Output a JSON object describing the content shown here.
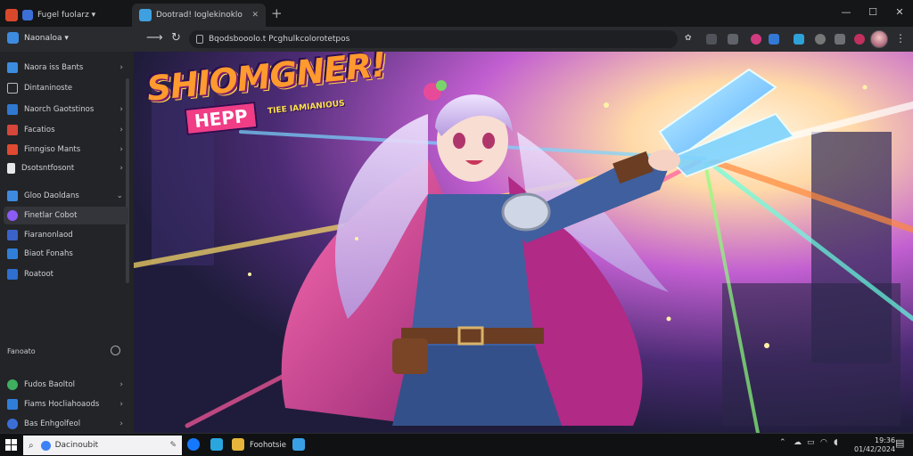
{
  "tabs": [
    {
      "title": "Fugel fuolarz ▾"
    },
    {
      "title": "Dootrad! Ioglekinoklo"
    }
  ],
  "new_tab_label": "+",
  "window_controls": {
    "minimize": "—",
    "maximize": "☐",
    "close": "✕"
  },
  "workspace": {
    "name": "Naonaloa ▾"
  },
  "nav": {
    "back": "⟶",
    "reload": "↻"
  },
  "address_bar": {
    "url": "Bqodsbooolo.t Pcghulkcolorotetpos"
  },
  "sidebar": {
    "items": [
      {
        "label": "Naora iss Bants",
        "chevron": "›"
      },
      {
        "label": "Dintaninoste",
        "chevron": ""
      },
      {
        "label": "Naorch Gaotstinos",
        "chevron": "›"
      },
      {
        "label": "Facatios",
        "chevron": "›"
      },
      {
        "label": "Finngiso Mants",
        "chevron": "›"
      },
      {
        "label": "Dsotsntfosont",
        "chevron": "›"
      },
      {
        "label": "Gloo Daoldans",
        "chevron": "⌄"
      },
      {
        "label": "Finetlar Cobot",
        "chevron": ""
      },
      {
        "label": "Fiaranonlaod",
        "chevron": ""
      },
      {
        "label": "Biaot Fonahs",
        "chevron": ""
      },
      {
        "label": "Roatoot",
        "chevron": ""
      }
    ],
    "section_label": "Fanoato",
    "bottom_items": [
      {
        "label": "Fudos Baoltol",
        "chevron": "›"
      },
      {
        "label": "Fiams Hocliahoaods",
        "chevron": "›"
      },
      {
        "label": "Bas Enhgolfeol",
        "chevron": "›"
      }
    ]
  },
  "artwork": {
    "title_line1": "SHIOMGNER!",
    "title_line2": "HEPP",
    "title_tagline": "TIEE IAMIANIOUS"
  },
  "taskbar": {
    "start_icon": "windows-logo",
    "search_placeholder": "Dacinoubit",
    "pinned_label": "Foohotsie",
    "clock_time": "19:36",
    "clock_date": "01/42/2024"
  }
}
